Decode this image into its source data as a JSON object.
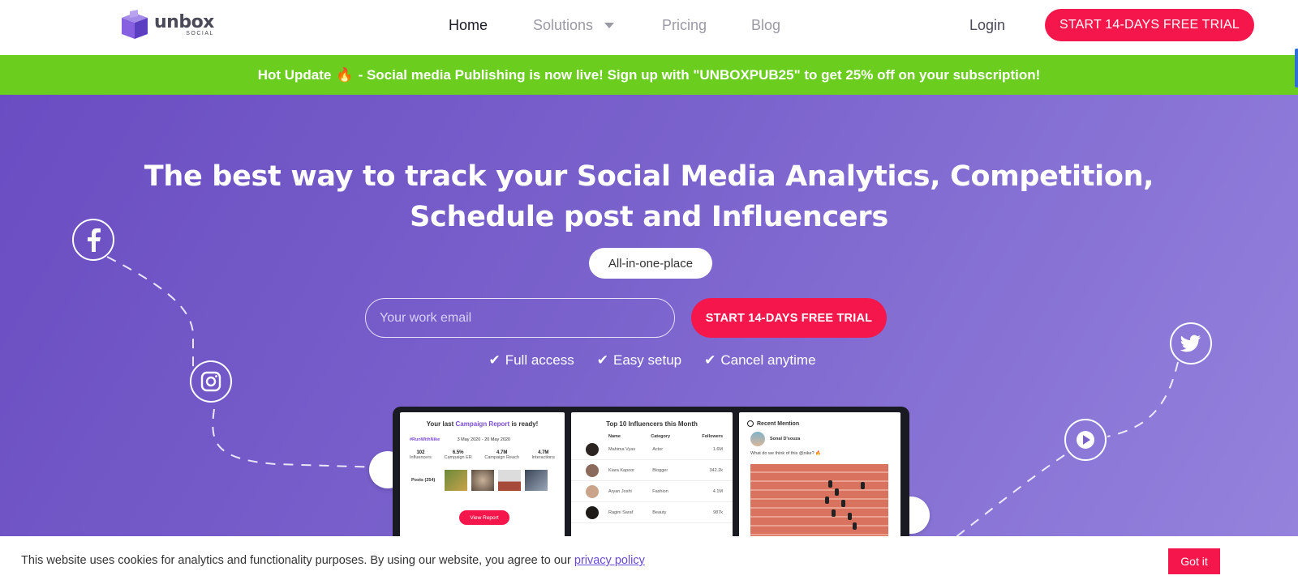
{
  "nav": {
    "logo_word": "unbox",
    "logo_sub": "SOCIAL",
    "links": {
      "home": "Home",
      "solutions": "Solutions",
      "pricing": "Pricing",
      "blog": "Blog"
    },
    "login": "Login",
    "cta": "START 14-DAYS FREE TRIAL"
  },
  "banner": {
    "prefix": "Hot Update",
    "icon": "fire-icon",
    "text": "- Social media Publishing is now live! Sign up with \"UNBOXPUB25\" to get 25% off on your subscription!"
  },
  "hero": {
    "title_line1": "The best way to track your Social Media Analytics, Competition,",
    "title_line2": "Schedule post and Influencers",
    "pill": "All-in-one-place",
    "email_placeholder": "Your work email",
    "cta": "START 14-DAYS FREE TRIAL",
    "checks": [
      "Full access",
      "Easy setup",
      "Cancel anytime"
    ]
  },
  "dashboard": {
    "campaign": {
      "title_prefix": "Your last",
      "title_highlight": "Campaign Report",
      "title_suffix": "is ready!",
      "tag": "#RunWithNike",
      "dates": "3 May 2020 - 20 May 2020",
      "stats": [
        {
          "value": "102",
          "label": "Influencers"
        },
        {
          "value": "6.5%",
          "label": "Campaign ER"
        },
        {
          "value": "4.7M",
          "label": "Campaign Reach"
        },
        {
          "value": "4.7M",
          "label": "Interactions"
        }
      ],
      "posts_label": "Posts (254)",
      "button": "View Report"
    },
    "influencers": {
      "title": "Top 10 Influencers this Month",
      "headers": [
        "Name",
        "Category",
        "Followers"
      ],
      "rows": [
        {
          "name": "Mahima Vyas",
          "category": "Actor",
          "followers": "1.6M"
        },
        {
          "name": "Kiara Kapoor",
          "category": "Blogger",
          "followers": "342.2k"
        },
        {
          "name": "Aryan Joshi",
          "category": "Fashion",
          "followers": "4.1M"
        },
        {
          "name": "Ragini Saraf",
          "category": "Beauty",
          "followers": "987k"
        }
      ]
    },
    "mention": {
      "title": "Recent Mention",
      "user": "Sonal D'souza",
      "text": "What do we think of this @nike? 🔥"
    }
  },
  "cookie": {
    "text": "This website uses cookies for analytics and functionality purposes. By using our website, you agree to our",
    "link": "privacy policy",
    "button": "Got it"
  },
  "colors": {
    "accent": "#f5174b",
    "banner": "#6bce1f",
    "hero_start": "#6a4dc2",
    "hero_end": "#9583dd",
    "highlight": "#7b4bd8"
  }
}
